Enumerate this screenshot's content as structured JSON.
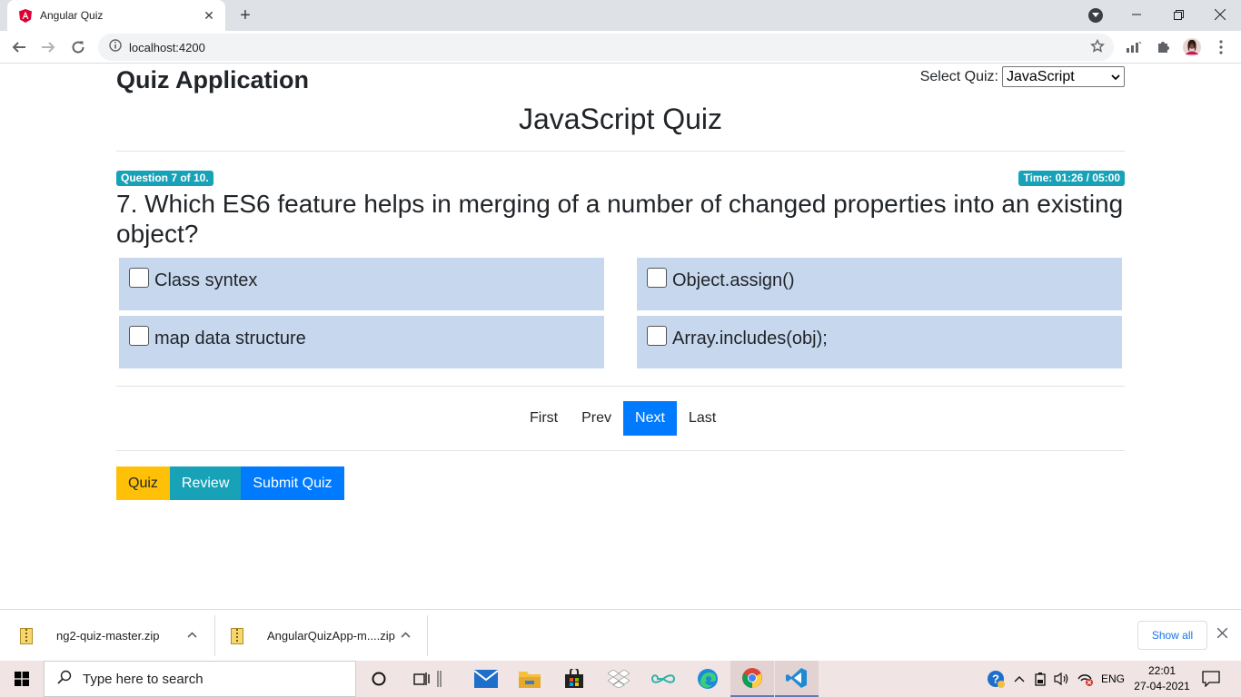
{
  "browser": {
    "tab_title": "Angular Quiz",
    "tab_close": "✕",
    "new_tab": "+",
    "url": "localhost:4200"
  },
  "header": {
    "app_title": "Quiz Application",
    "select_label": "Select Quiz:",
    "selected_quiz": "JavaScript"
  },
  "quiz": {
    "title": "JavaScript Quiz",
    "question_badge": "Question 7 of 10.",
    "timer": "Time: 01:26 / 05:00",
    "question": "7. Which ES6 feature helps in merging of a number of changed properties into an existing object?",
    "options": [
      {
        "label": "Class syntex",
        "checked": false
      },
      {
        "label": "Object.assign()",
        "checked": false
      },
      {
        "label": "map data structure",
        "checked": false
      },
      {
        "label": "Array.includes(obj);",
        "checked": false
      }
    ]
  },
  "pager": {
    "first": "First",
    "prev": "Prev",
    "next": "Next",
    "last": "Last",
    "active": "Next"
  },
  "actions": {
    "quiz": "Quiz",
    "review": "Review",
    "submit": "Submit Quiz"
  },
  "downloads": {
    "items": [
      "ng2-quiz-master.zip",
      "AngularQuizApp-m....zip"
    ],
    "show_all": "Show all"
  },
  "taskbar": {
    "search_placeholder": "Type here to search",
    "language": "ENG",
    "time": "22:01",
    "date": "27-04-2021"
  },
  "colors": {
    "primary": "#007bff",
    "info": "#17a2b8",
    "warning": "#ffc107",
    "option_bg": "#c7d8ee"
  }
}
